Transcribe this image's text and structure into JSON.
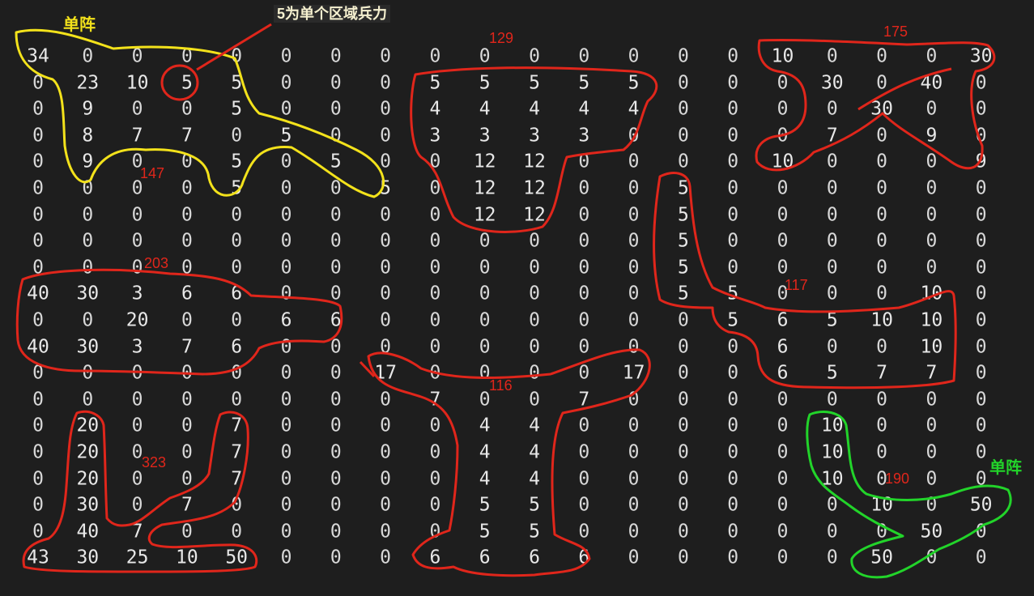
{
  "grid": {
    "rows": [
      [
        "34",
        "0",
        "0",
        "0",
        "0",
        "0",
        "0",
        "0",
        "0",
        "0",
        "0",
        "0",
        "0",
        "0",
        "0",
        "10",
        "0",
        "0",
        "0",
        "30"
      ],
      [
        "0",
        "23",
        "10",
        "5",
        "5",
        "0",
        "0",
        "0",
        "5",
        "5",
        "5",
        "5",
        "5",
        "0",
        "0",
        "0",
        "30",
        "0",
        "40",
        "0"
      ],
      [
        "0",
        "9",
        "0",
        "0",
        "5",
        "0",
        "0",
        "0",
        "4",
        "4",
        "4",
        "4",
        "4",
        "0",
        "0",
        "0",
        "0",
        "30",
        "0",
        "0"
      ],
      [
        "0",
        "8",
        "7",
        "7",
        "0",
        "5",
        "0",
        "0",
        "3",
        "3",
        "3",
        "3",
        "0",
        "0",
        "0",
        "0",
        "7",
        "0",
        "9",
        "0"
      ],
      [
        "0",
        "9",
        "0",
        "0",
        "5",
        "0",
        "5",
        "0",
        "0",
        "12",
        "12",
        "0",
        "0",
        "0",
        "0",
        "10",
        "0",
        "0",
        "0",
        "9"
      ],
      [
        "0",
        "0",
        "0",
        "0",
        "5",
        "0",
        "0",
        "5",
        "0",
        "12",
        "12",
        "0",
        "0",
        "5",
        "0",
        "0",
        "0",
        "0",
        "0",
        "0"
      ],
      [
        "0",
        "0",
        "0",
        "0",
        "0",
        "0",
        "0",
        "0",
        "0",
        "12",
        "12",
        "0",
        "0",
        "5",
        "0",
        "0",
        "0",
        "0",
        "0",
        "0"
      ],
      [
        "0",
        "0",
        "0",
        "0",
        "0",
        "0",
        "0",
        "0",
        "0",
        "0",
        "0",
        "0",
        "0",
        "5",
        "0",
        "0",
        "0",
        "0",
        "0",
        "0"
      ],
      [
        "0",
        "0",
        "0",
        "0",
        "0",
        "0",
        "0",
        "0",
        "0",
        "0",
        "0",
        "0",
        "0",
        "5",
        "0",
        "0",
        "0",
        "0",
        "0",
        "0"
      ],
      [
        "40",
        "30",
        "3",
        "6",
        "6",
        "0",
        "0",
        "0",
        "0",
        "0",
        "0",
        "0",
        "0",
        "5",
        "5",
        "0",
        "0",
        "0",
        "10",
        "0"
      ],
      [
        "0",
        "0",
        "20",
        "0",
        "0",
        "6",
        "6",
        "0",
        "0",
        "0",
        "0",
        "0",
        "0",
        "0",
        "5",
        "6",
        "5",
        "10",
        "10",
        "0"
      ],
      [
        "40",
        "30",
        "3",
        "7",
        "6",
        "0",
        "0",
        "0",
        "0",
        "0",
        "0",
        "0",
        "0",
        "0",
        "0",
        "6",
        "0",
        "0",
        "10",
        "0"
      ],
      [
        "0",
        "0",
        "0",
        "0",
        "0",
        "0",
        "0",
        "17",
        "0",
        "0",
        "0",
        "0",
        "17",
        "0",
        "0",
        "6",
        "5",
        "7",
        "7",
        "0"
      ],
      [
        "0",
        "0",
        "0",
        "0",
        "0",
        "0",
        "0",
        "0",
        "7",
        "0",
        "0",
        "7",
        "0",
        "0",
        "0",
        "0",
        "0",
        "0",
        "0",
        "0"
      ],
      [
        "0",
        "20",
        "0",
        "0",
        "7",
        "0",
        "0",
        "0",
        "0",
        "4",
        "4",
        "0",
        "0",
        "0",
        "0",
        "0",
        "10",
        "0",
        "0",
        "0"
      ],
      [
        "0",
        "20",
        "0",
        "0",
        "7",
        "0",
        "0",
        "0",
        "0",
        "4",
        "4",
        "0",
        "0",
        "0",
        "0",
        "0",
        "10",
        "0",
        "0",
        "0"
      ],
      [
        "0",
        "20",
        "0",
        "0",
        "7",
        "0",
        "0",
        "0",
        "0",
        "4",
        "4",
        "0",
        "0",
        "0",
        "0",
        "0",
        "10",
        "0",
        "0",
        "0"
      ],
      [
        "0",
        "30",
        "0",
        "7",
        "0",
        "0",
        "0",
        "0",
        "0",
        "5",
        "5",
        "0",
        "0",
        "0",
        "0",
        "0",
        "0",
        "10",
        "0",
        "50"
      ],
      [
        "0",
        "40",
        "7",
        "0",
        "0",
        "0",
        "0",
        "0",
        "0",
        "5",
        "5",
        "0",
        "0",
        "0",
        "0",
        "0",
        "0",
        "0",
        "50",
        "0"
      ],
      [
        "43",
        "30",
        "25",
        "10",
        "50",
        "0",
        "0",
        "0",
        "6",
        "6",
        "6",
        "6",
        "0",
        "0",
        "0",
        "0",
        "0",
        "50",
        "0",
        "0"
      ]
    ]
  },
  "annotations": {
    "callout": "5为单个区域兵力",
    "single_formation_yellow": "单阵",
    "single_formation_green": "单阵",
    "region_totals": [
      "147",
      "129",
      "175",
      "203",
      "117",
      "116",
      "323",
      "190"
    ]
  },
  "colors": {
    "background": "#1e1e1e",
    "red_outline": "#e0261b",
    "yellow_outline": "#f3e21b",
    "green_outline": "#22d42a"
  }
}
